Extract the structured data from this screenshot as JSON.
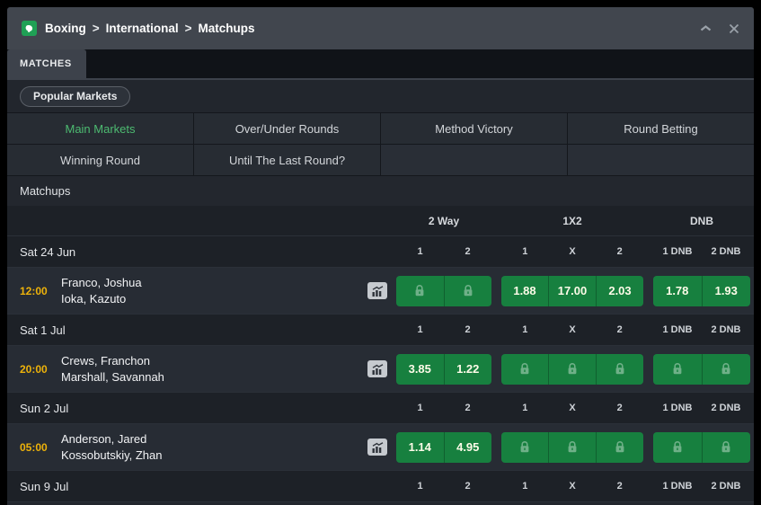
{
  "window": {
    "breadcrumb": {
      "items": [
        "Boxing",
        "International",
        "Matchups"
      ],
      "separator": ">"
    }
  },
  "tabs": {
    "matches": "MATCHES"
  },
  "filters": {
    "popular_markets": "Popular Markets"
  },
  "market_tabs": {
    "active": "Main Markets",
    "items": [
      "Main Markets",
      "Over/Under Rounds",
      "Method Victory",
      "Round Betting",
      "Winning Round",
      "Until The Last Round?"
    ]
  },
  "section": {
    "title": "Matchups"
  },
  "odds_header": {
    "groups": [
      "2 Way",
      "1X2",
      "DNB"
    ],
    "sub": {
      "two_way": [
        "1",
        "2"
      ],
      "one_x_two": [
        "1",
        "X",
        "2"
      ],
      "dnb": [
        "1 DNB",
        "2 DNB"
      ]
    }
  },
  "sections": [
    {
      "date": "Sat 24 Jun",
      "matches": [
        {
          "time": "12:00",
          "fighters": [
            "Franco, Joshua",
            "Ioka, Kazuto"
          ],
          "two_way": {
            "locked": true
          },
          "one_x_two": {
            "locked": false,
            "values": [
              "1.88",
              "17.00",
              "2.03"
            ]
          },
          "dnb": {
            "locked": false,
            "values": [
              "1.78",
              "1.93"
            ]
          }
        }
      ]
    },
    {
      "date": "Sat 1 Jul",
      "matches": [
        {
          "time": "20:00",
          "fighters": [
            "Crews, Franchon",
            "Marshall, Savannah"
          ],
          "two_way": {
            "locked": false,
            "values": [
              "3.85",
              "1.22"
            ]
          },
          "one_x_two": {
            "locked": true
          },
          "dnb": {
            "locked": true
          }
        }
      ]
    },
    {
      "date": "Sun 2 Jul",
      "matches": [
        {
          "time": "05:00",
          "fighters": [
            "Anderson, Jared",
            "Kossobutskiy, Zhan"
          ],
          "two_way": {
            "locked": false,
            "values": [
              "1.14",
              "4.95"
            ]
          },
          "one_x_two": {
            "locked": true
          },
          "dnb": {
            "locked": true
          }
        }
      ]
    },
    {
      "date": "Sun 9 Jul",
      "matches": []
    }
  ],
  "colors": {
    "odds_green": "#17803f",
    "active_tab_green": "#4dbb71",
    "time_yellow": "#edb20a",
    "odds_text": "#fdfbe8"
  }
}
